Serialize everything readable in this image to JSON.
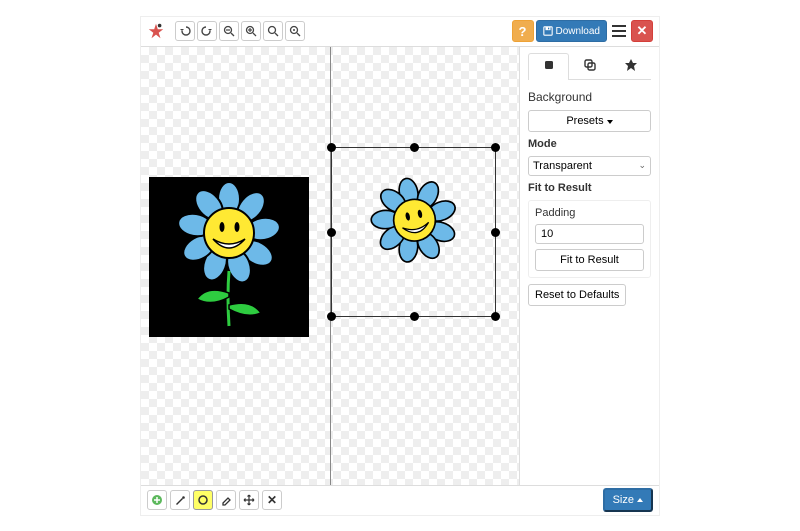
{
  "toolbar": {
    "download_label": "Download"
  },
  "sidebar": {
    "title": "Background",
    "presets_label": "Presets",
    "mode_label": "Mode",
    "mode_value": "Transparent",
    "fit_title": "Fit to Result",
    "padding_label": "Padding",
    "padding_value": "10",
    "fit_button": "Fit to Result",
    "reset_button": "Reset to Defaults"
  },
  "bottombar": {
    "size_label": "Size"
  }
}
